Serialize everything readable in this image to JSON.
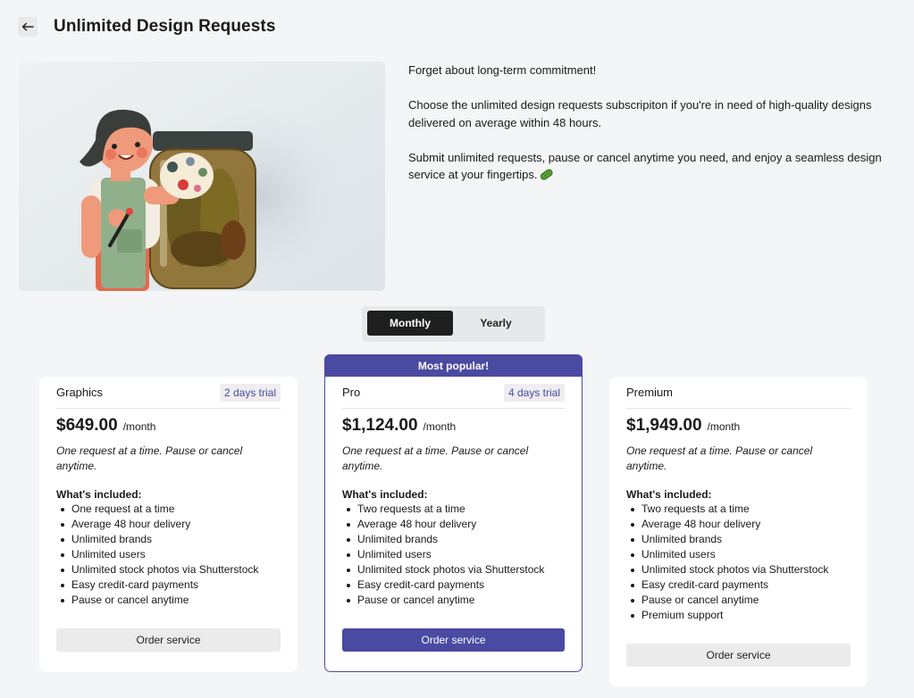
{
  "header": {
    "title": "Unlimited Design Requests"
  },
  "intro": {
    "p1": "Forget about long-term commitment!",
    "p2": "Choose the unlimited design requests subscripiton if you're in need of high-quality designs delivered on average within 48 hours.",
    "p3": "Submit unlimited requests, pause or cancel anytime you need, and enjoy a seamless design service at your fingertips."
  },
  "billing_toggle": {
    "monthly": "Monthly",
    "yearly": "Yearly",
    "selected": "Monthly"
  },
  "popular_banner": "Most popular!",
  "plans": [
    {
      "name": "Graphics",
      "trial": "2 days trial",
      "price": "$649.00",
      "per": "/month",
      "description": "One request at a time. Pause or cancel anytime.",
      "included_title": "What's included:",
      "features": [
        "One request at a time",
        "Average 48 hour delivery",
        "Unlimited brands",
        "Unlimited users",
        "Unlimited stock photos via Shutterstock",
        "Easy credit-card payments",
        "Pause or cancel anytime"
      ],
      "cta": "Order service"
    },
    {
      "name": "Pro",
      "trial": "4 days trial",
      "price": "$1,124.00",
      "per": "/month",
      "description": "One request at a time. Pause or cancel anytime.",
      "included_title": "What's included:",
      "features": [
        "Two requests at a time",
        "Average 48 hour delivery",
        "Unlimited brands",
        "Unlimited users",
        "Unlimited stock photos via Shutterstock",
        "Easy credit-card payments",
        "Pause or cancel anytime"
      ],
      "cta": "Order service"
    },
    {
      "name": "Premium",
      "trial": "",
      "price": "$1,949.00",
      "per": "/month",
      "description": "One request at a time. Pause or cancel anytime.",
      "included_title": "What's included:",
      "features": [
        "Two requests at a time",
        "Average 48 hour delivery",
        "Unlimited brands",
        "Unlimited users",
        "Unlimited stock photos via Shutterstock",
        "Easy credit-card payments",
        "Pause or cancel anytime",
        "Premium support"
      ],
      "cta": "Order service"
    }
  ],
  "colors": {
    "accent": "#4a4aa3",
    "dark": "#1f1f1f",
    "background": "#f4f5f6"
  },
  "icons": {
    "back": "arrow-left-icon",
    "pickle": "pickle-icon"
  }
}
